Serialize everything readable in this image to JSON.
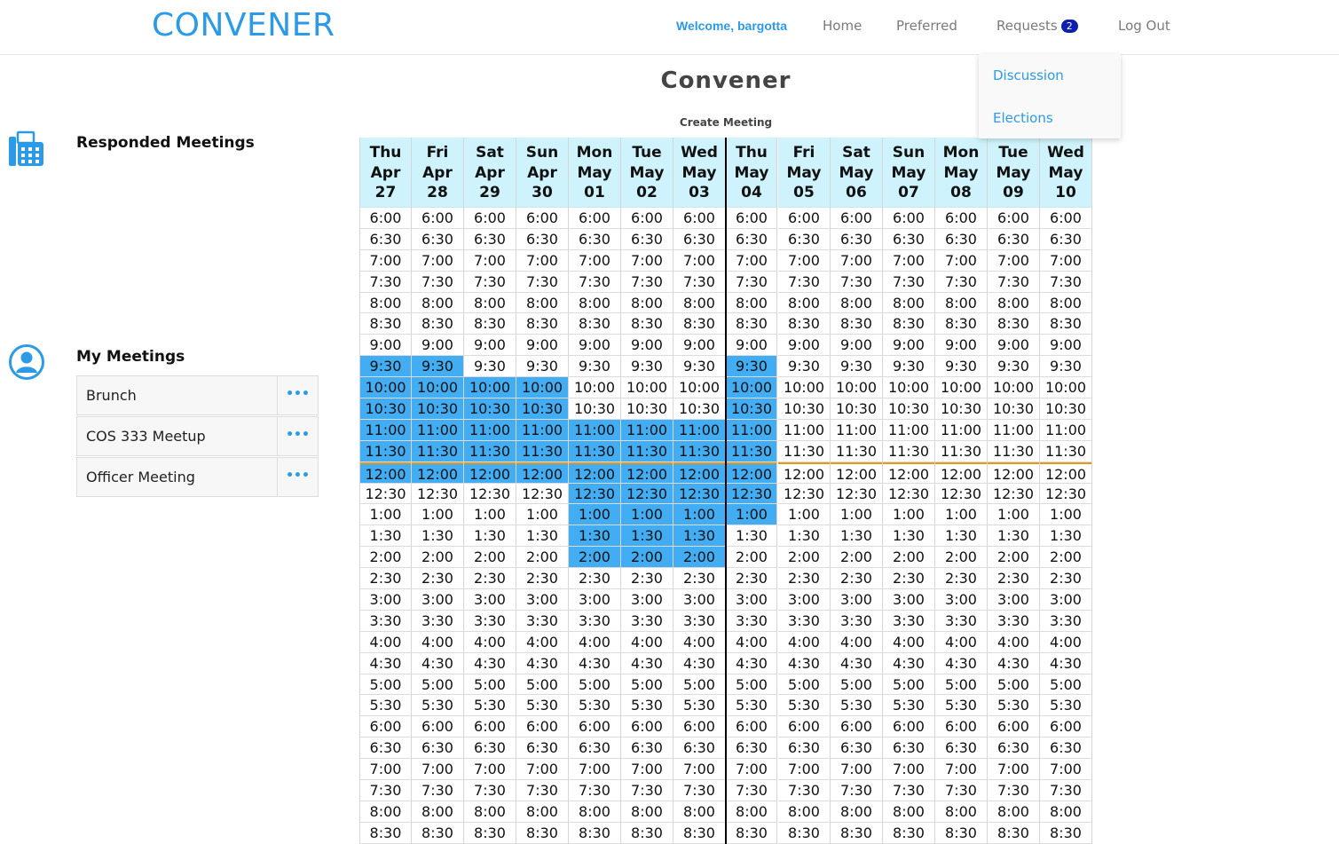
{
  "header": {
    "brand": "CONVENER",
    "welcome": "Welcome, bargotta",
    "nav": {
      "home": "Home",
      "preferred": "Preferred",
      "requests": "Requests",
      "requests_badge": "2",
      "logout": "Log Out"
    },
    "dropdown": {
      "discussion": "Discussion",
      "elections": "Elections"
    }
  },
  "page": {
    "title": "Convener",
    "create_link": "Create Meeting"
  },
  "sidebar": {
    "responded_title": "Responded Meetings",
    "my_meetings_title": "My Meetings",
    "my_meetings": [
      {
        "name": "Brunch",
        "more": "•••"
      },
      {
        "name": "COS 333 Meetup",
        "more": "•••"
      },
      {
        "name": "Officer Meeting",
        "more": "•••"
      }
    ]
  },
  "schedule": {
    "days": [
      {
        "dow": "Thu",
        "mon": "Apr",
        "day": "27"
      },
      {
        "dow": "Fri",
        "mon": "Apr",
        "day": "28"
      },
      {
        "dow": "Sat",
        "mon": "Apr",
        "day": "29"
      },
      {
        "dow": "Sun",
        "mon": "Apr",
        "day": "30"
      },
      {
        "dow": "Mon",
        "mon": "May",
        "day": "01"
      },
      {
        "dow": "Tue",
        "mon": "May",
        "day": "02"
      },
      {
        "dow": "Wed",
        "mon": "May",
        "day": "03"
      },
      {
        "dow": "Thu",
        "mon": "May",
        "day": "04"
      },
      {
        "dow": "Fri",
        "mon": "May",
        "day": "05"
      },
      {
        "dow": "Sat",
        "mon": "May",
        "day": "06"
      },
      {
        "dow": "Sun",
        "mon": "May",
        "day": "07"
      },
      {
        "dow": "Mon",
        "mon": "May",
        "day": "08"
      },
      {
        "dow": "Tue",
        "mon": "May",
        "day": "09"
      },
      {
        "dow": "Wed",
        "mon": "May",
        "day": "10"
      }
    ],
    "times": [
      "6:00",
      "6:30",
      "7:00",
      "7:30",
      "8:00",
      "8:30",
      "9:00",
      "9:30",
      "10:00",
      "10:30",
      "11:00",
      "11:30",
      "12:00",
      "12:30",
      "1:00",
      "1:30",
      "2:00",
      "2:30",
      "3:00",
      "3:30",
      "4:00",
      "4:30",
      "5:00",
      "5:30",
      "6:00",
      "6:30",
      "7:00",
      "7:30",
      "8:00",
      "8:30"
    ],
    "selected": [
      [
        "9:30",
        "10:00",
        "10:30",
        "11:00",
        "11:30",
        "12:00"
      ],
      [
        "9:30",
        "10:00",
        "10:30",
        "11:00",
        "11:30",
        "12:00"
      ],
      [
        "10:00",
        "10:30",
        "11:00",
        "11:30",
        "12:00"
      ],
      [
        "10:00",
        "10:30",
        "11:00",
        "11:30",
        "12:00"
      ],
      [
        "11:00",
        "11:30",
        "12:00",
        "12:30",
        "1:00",
        "1:30",
        "2:00"
      ],
      [
        "11:00",
        "11:30",
        "12:00",
        "12:30",
        "1:00",
        "1:30",
        "2:00"
      ],
      [
        "11:00",
        "11:30",
        "12:00",
        "12:30",
        "1:00",
        "1:30",
        "2:00"
      ],
      [
        "9:30",
        "10:00",
        "10:30",
        "11:00",
        "11:30",
        "12:00",
        "12:30",
        "1:00"
      ],
      [],
      [],
      [],
      [],
      [],
      []
    ]
  },
  "colors": {
    "accent": "#2b9be8",
    "selected": "#42adf2",
    "header_bg": "#cff3fc",
    "noon_line": "#e59a14",
    "badge": "#0e1fae"
  }
}
